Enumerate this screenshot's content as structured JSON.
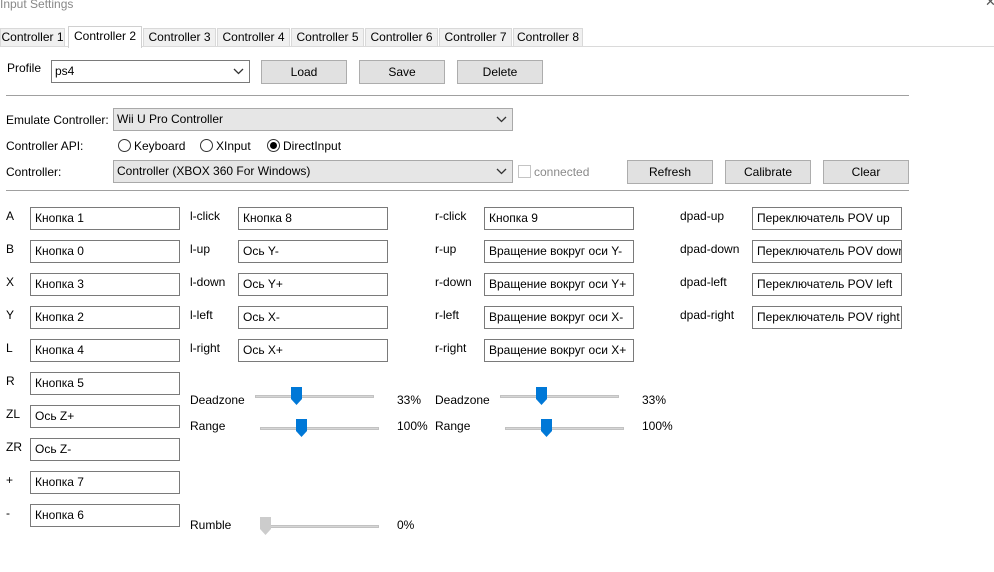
{
  "window": {
    "title": "Input Settings"
  },
  "tabs": [
    "Controller 1",
    "Controller 2",
    "Controller 3",
    "Controller 4",
    "Controller 5",
    "Controller 6",
    "Controller 7",
    "Controller 8"
  ],
  "active_tab": 1,
  "profile": {
    "label": "Profile",
    "value": "ps4",
    "load": "Load",
    "save": "Save",
    "delete": "Delete"
  },
  "emulate": {
    "label": "Emulate Controller:",
    "value": "Wii U Pro Controller"
  },
  "api": {
    "label": "Controller API:",
    "options": [
      "Keyboard",
      "XInput",
      "DirectInput"
    ],
    "selected": "DirectInput"
  },
  "controller": {
    "label": "Controller:",
    "value": "Controller (XBOX 360 For Windows)",
    "connected": "connected",
    "refresh": "Refresh",
    "calibrate": "Calibrate",
    "clear": "Clear"
  },
  "buttons": [
    {
      "label": "A",
      "value": "Кнопка 1"
    },
    {
      "label": "B",
      "value": "Кнопка 0"
    },
    {
      "label": "X",
      "value": "Кнопка 3"
    },
    {
      "label": "Y",
      "value": "Кнопка 2"
    },
    {
      "label": "L",
      "value": "Кнопка 4"
    },
    {
      "label": "R",
      "value": "Кнопка 5"
    },
    {
      "label": "ZL",
      "value": "Ось Z+"
    },
    {
      "label": "ZR",
      "value": "Ось Z-"
    },
    {
      "label": "+",
      "value": "Кнопка 7"
    },
    {
      "label": "-",
      "value": "Кнопка 6"
    }
  ],
  "left_stick": [
    {
      "label": "l-click",
      "value": "Кнопка 8"
    },
    {
      "label": "l-up",
      "value": "Ось Y-"
    },
    {
      "label": "l-down",
      "value": "Ось Y+"
    },
    {
      "label": "l-left",
      "value": "Ось X-"
    },
    {
      "label": "l-right",
      "value": "Ось X+"
    }
  ],
  "right_stick": [
    {
      "label": "r-click",
      "value": "Кнопка 9"
    },
    {
      "label": "r-up",
      "value": "Вращение вокруг оси Y-"
    },
    {
      "label": "r-down",
      "value": "Вращение вокруг оси Y+"
    },
    {
      "label": "r-left",
      "value": "Вращение вокруг оси X-"
    },
    {
      "label": "r-right",
      "value": "Вращение вокруг оси X+"
    }
  ],
  "dpad": [
    {
      "label": "dpad-up",
      "value": "Переключатель POV up"
    },
    {
      "label": "dpad-down",
      "value": "Переключатель POV down"
    },
    {
      "label": "dpad-left",
      "value": "Переключатель POV left"
    },
    {
      "label": "dpad-right",
      "value": "Переключатель POV right"
    }
  ],
  "left_settings": {
    "deadzone": {
      "label": "Deadzone",
      "text": "33%",
      "value": 0.33
    },
    "range": {
      "label": "Range",
      "text": "100%",
      "value": 0.33
    }
  },
  "right_settings": {
    "deadzone": {
      "label": "Deadzone",
      "text": "33%",
      "value": 0.33
    },
    "range": {
      "label": "Range",
      "text": "100%",
      "value": 0.33
    }
  },
  "rumble": {
    "label": "Rumble",
    "text": "0%",
    "value": 0
  },
  "colors": {
    "accent": "#0078d7",
    "disabled_thumb": "#cccccc"
  },
  "icons": {
    "close": "close-icon",
    "dropdown": "chevron-down-icon"
  }
}
